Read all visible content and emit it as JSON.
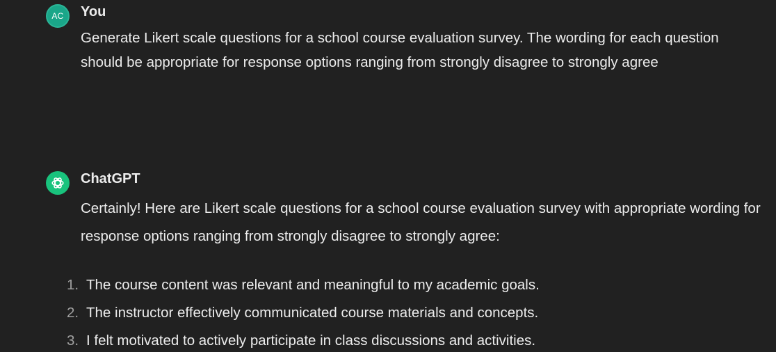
{
  "user_message": {
    "avatar_initials": "AC",
    "author": "You",
    "text": "Generate Likert scale questions for a school course evaluation survey. The wording for each question should be appropriate for response options ranging from strongly disagree to strongly agree"
  },
  "assistant_message": {
    "avatar_icon": "openai-logo-icon",
    "author": "ChatGPT",
    "intro": "Certainly! Here are Likert scale questions for a school course evaluation survey with appropriate wording for response options ranging from strongly disagree to strongly agree:",
    "items": [
      {
        "number": "1.",
        "text": "The course content was relevant and meaningful to my academic goals."
      },
      {
        "number": "2.",
        "text": "The instructor effectively communicated course materials and concepts."
      },
      {
        "number": "3.",
        "text": "I felt motivated to actively participate in class discussions and activities."
      }
    ]
  },
  "colors": {
    "background": "#212121",
    "text": "#ececec",
    "user_avatar": "#1aa689",
    "assistant_avatar": "#19c37d",
    "list_number": "#a0a0a0"
  }
}
